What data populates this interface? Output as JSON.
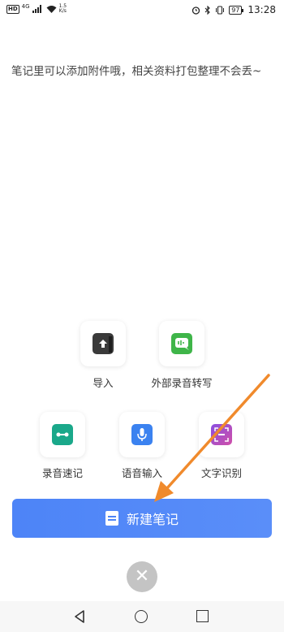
{
  "status_bar": {
    "hd": "HD",
    "network": "4G",
    "speed_value": "1.5",
    "speed_unit": "K/s",
    "battery": "97",
    "time": "13:28"
  },
  "note": {
    "text": "笔记里可以添加附件哦，相关资料打包整理不会丢~"
  },
  "actions": {
    "import": {
      "label": "导入",
      "icon": "upload-icon",
      "color": "#3a3a3a"
    },
    "external_recording": {
      "label": "外部录音转写",
      "icon": "audio-chat-icon",
      "color": "#3fb549"
    },
    "quick_record": {
      "label": "录音速记",
      "icon": "tape-icon",
      "color": "#1aa88a"
    },
    "voice_input": {
      "label": "语音输入",
      "icon": "microphone-icon",
      "color": "#3b82f0"
    },
    "text_recognition": {
      "label": "文字识别",
      "icon": "scan-text-icon",
      "color": "#8a4fe0"
    }
  },
  "new_note_button": {
    "label": "新建笔记",
    "color": "#4d84f7"
  },
  "annotation_arrow": {
    "color": "#f08a2c"
  }
}
